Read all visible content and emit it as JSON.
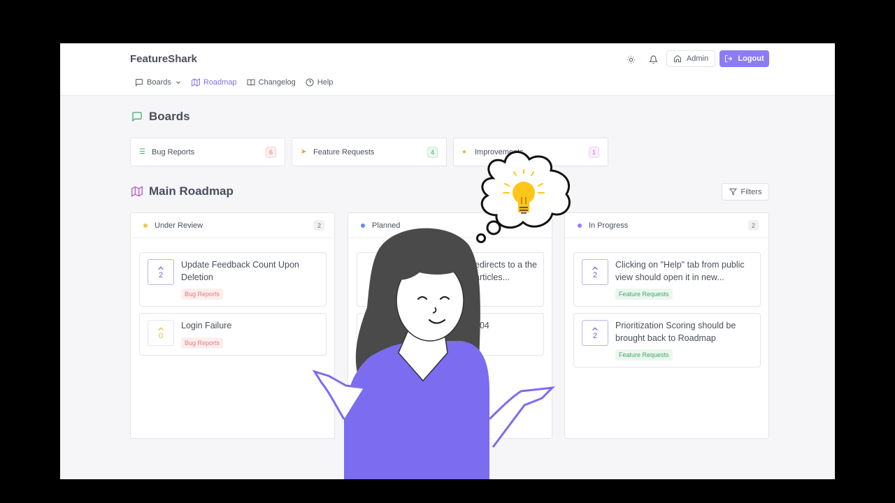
{
  "app": {
    "brand": "FeatureShark"
  },
  "header": {
    "admin_label": "Admin",
    "logout_label": "Logout"
  },
  "nav": {
    "boards": "Boards",
    "roadmap": "Roadmap",
    "changelog": "Changelog",
    "help": "Help"
  },
  "boards_section": {
    "title": "Boards",
    "items": [
      {
        "label": "Bug Reports",
        "count": "6",
        "color": "#e07a7a"
      },
      {
        "label": "Feature Requests",
        "count": "4",
        "color": "#46a56c"
      },
      {
        "label": "Improvements",
        "count": "1",
        "color": "#c86ad8"
      }
    ]
  },
  "roadmap": {
    "title": "Main Roadmap",
    "filters_label": "Filters",
    "columns": [
      {
        "title": "Under Review",
        "count": "2",
        "dot_color": "#f2c94c",
        "cards": [
          {
            "votes": "2",
            "title": "Update Feedback Count Upon Deletion",
            "tag": "Bug Reports"
          },
          {
            "votes": "0",
            "title": "Login Failure",
            "tag": "Bug Reports"
          }
        ]
      },
      {
        "title": "Planned",
        "count": "",
        "dot_color": "#5b8def",
        "cards": [
          {
            "votes": "",
            "title": "edirects to a the articles...",
            "tag": ""
          },
          {
            "votes": "",
            "title": "404",
            "tag": ""
          }
        ]
      },
      {
        "title": "In Progress",
        "count": "2",
        "dot_color": "#9b7cf0",
        "cards": [
          {
            "votes": "2",
            "title": "Clicking on \"Help\" tab from public view should open it in new...",
            "tag": "Feature Requests"
          },
          {
            "votes": "2",
            "title": "Prioritization Scoring should be brought back to Roadmap",
            "tag": "Feature Requests"
          }
        ]
      }
    ]
  }
}
